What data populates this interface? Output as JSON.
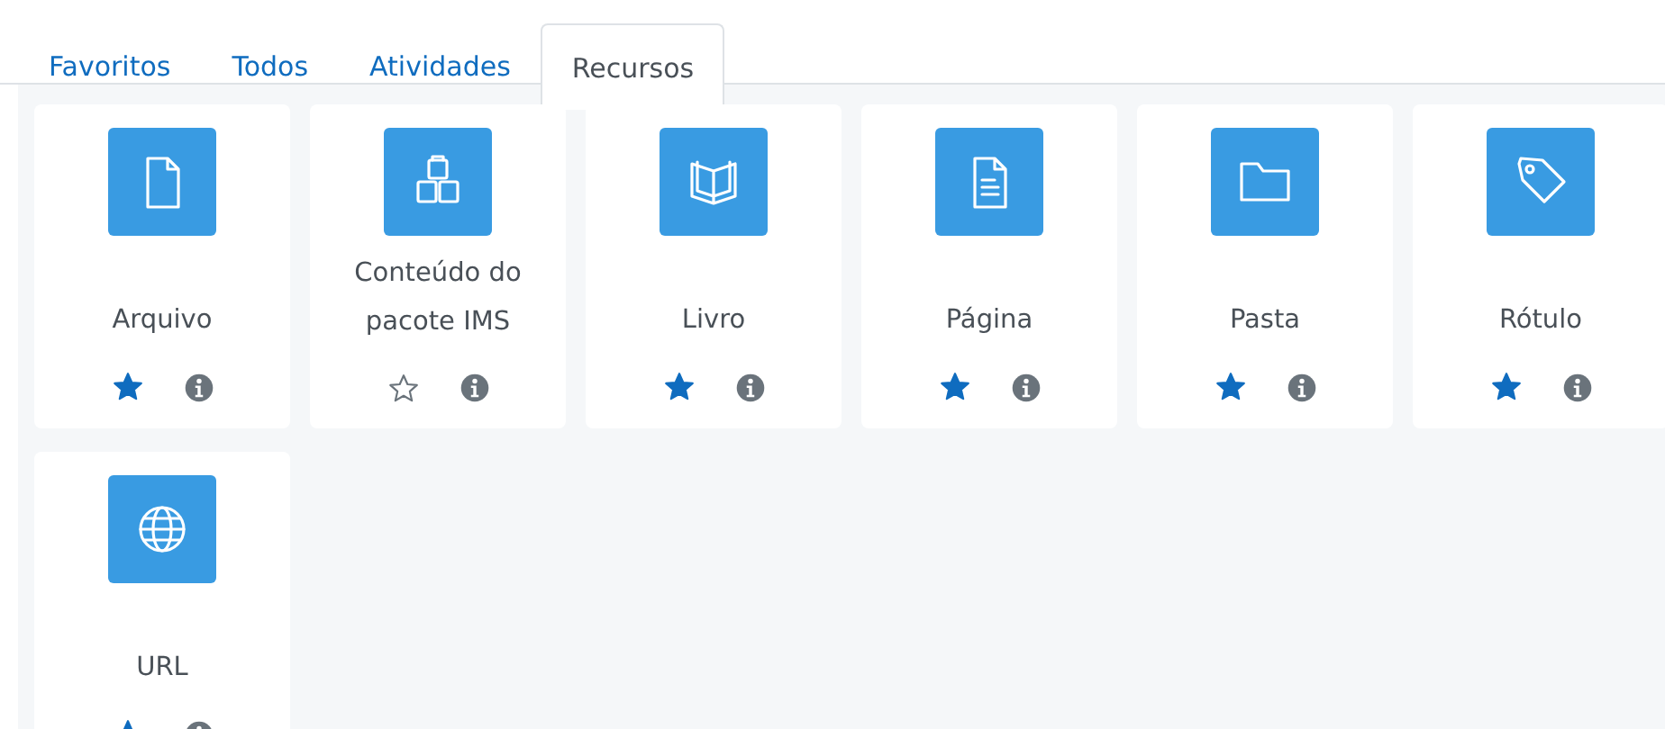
{
  "tabs": [
    {
      "label": "Favoritos",
      "selected": false
    },
    {
      "label": "Todos",
      "selected": false
    },
    {
      "label": "Atividades",
      "selected": false
    },
    {
      "label": "Recursos",
      "selected": true
    }
  ],
  "items": [
    {
      "kind": "file",
      "label": "Arquivo",
      "starred": true
    },
    {
      "kind": "package",
      "label": "Conteúdo do pacote IMS",
      "starred": false
    },
    {
      "kind": "book",
      "label": "Livro",
      "starred": true
    },
    {
      "kind": "page",
      "label": "Página",
      "starred": true
    },
    {
      "kind": "folder",
      "label": "Pasta",
      "starred": true
    },
    {
      "kind": "tag",
      "label": "Rótulo",
      "starred": true
    },
    {
      "kind": "globe",
      "label": "URL",
      "starred": true
    }
  ]
}
